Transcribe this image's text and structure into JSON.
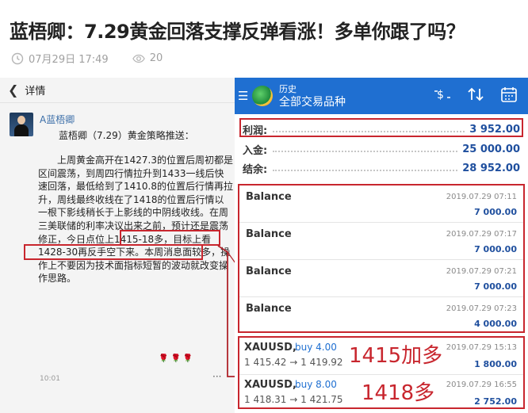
{
  "article": {
    "title": "蓝梧卿：7.29黄金回落支撑反弹看涨！多单你跟了吗？",
    "date": "07月29日 17:49",
    "views": "20"
  },
  "chat": {
    "header_title": "详情",
    "sender": "A蓝梧卿",
    "intro": "蓝梧卿（7.29）黄金策略推送：",
    "message": "上周黄金高开在1427.3的位置后周初都是区间震荡，到周四行情拉升到1433一线后快速回落，最低给到了1410.8的位置后行情再拉升，周线最终收线在了1418的位置后行情以一根下影线稍长于上影线的中阴线收线。在周三美联储的利率决议出来之前，预计还是震荡修正，今日点位上1415-18多，目标上看1428-30再反手空下来。本周消息面较多，操作上不要因为技术面指标短暂的波动就改变操作思路。",
    "roses": "🌹🌹🌹",
    "time": "10:01",
    "more": "···"
  },
  "history": {
    "title_small": "历史",
    "title_main": "全部交易品种",
    "summary": [
      {
        "label": "利润:",
        "value": "3 952.00"
      },
      {
        "label": "入金:",
        "value": "25 000.00"
      },
      {
        "label": "结余:",
        "value": "28 952.00"
      }
    ],
    "deals": [
      {
        "name": "Balance",
        "date": "2019.07.29 07:11",
        "amount": "7 000.00"
      },
      {
        "name": "Balance",
        "date": "2019.07.29 07:17",
        "amount": "7 000.00"
      },
      {
        "name": "Balance",
        "date": "2019.07.29 07:21",
        "amount": "7 000.00"
      },
      {
        "name": "Balance",
        "date": "2019.07.29 07:23",
        "amount": "4 000.00"
      }
    ],
    "trades": [
      {
        "symbol": "XAUUSD,",
        "side": "buy 4.00",
        "prices": "1 415.42 → 1 419.92",
        "date": "2019.07.29 15:13",
        "profit": "1 800.00",
        "note": "1415加多"
      },
      {
        "symbol": "XAUUSD,",
        "side": "buy 8.00",
        "prices": "1 418.31 → 1 421.75",
        "date": "2019.07.29 16:55",
        "profit": "2 752.00",
        "note": "1418多"
      }
    ]
  },
  "colors": {
    "accent": "#1f6fd1",
    "highlight": "#c8262e",
    "value": "#1f4f9e"
  }
}
